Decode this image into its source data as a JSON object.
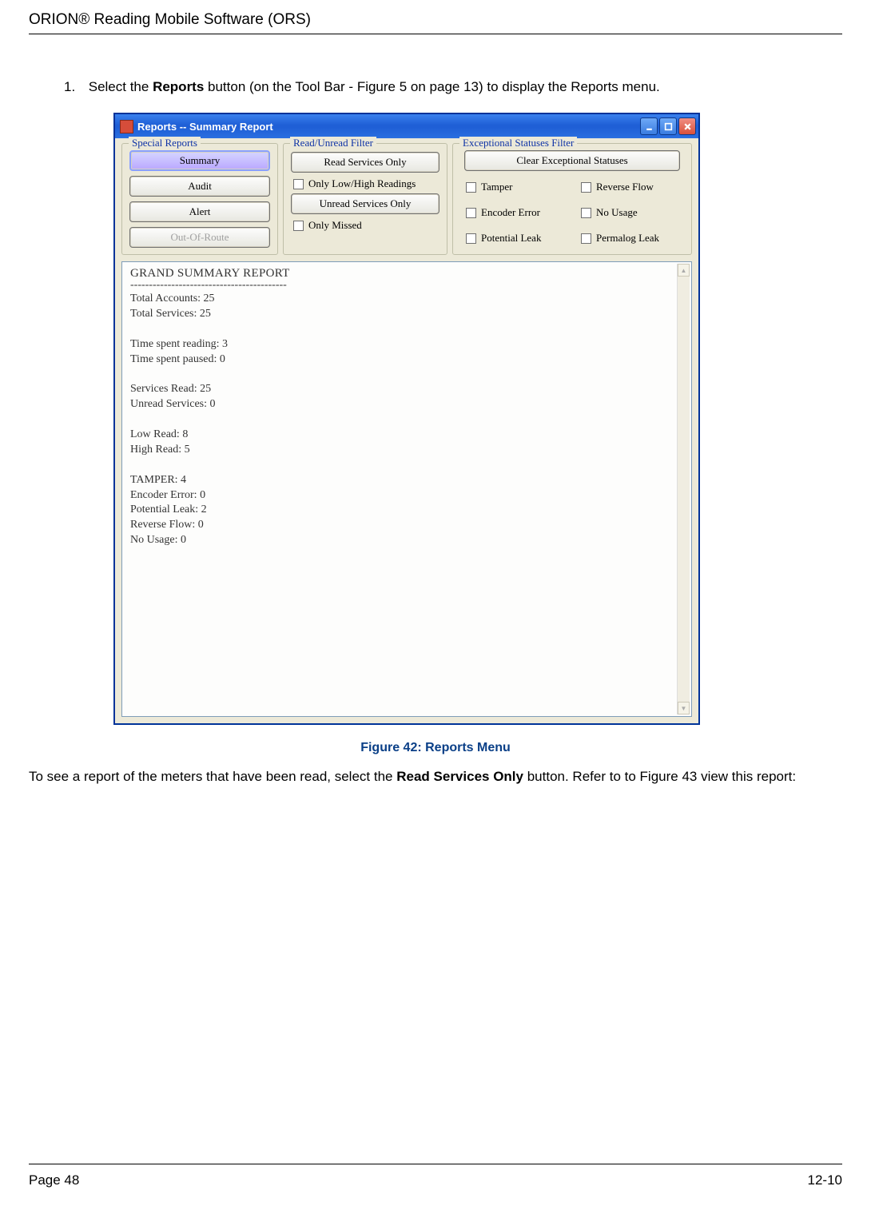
{
  "header": {
    "title": "ORION® Reading Mobile Software (ORS)"
  },
  "instruction": {
    "number": "1.",
    "prefix": "Select the ",
    "bold": "Reports",
    "suffix": " button (on the Tool Bar - Figure 5 on page 13) to display the Reports menu."
  },
  "window": {
    "title": "Reports  -- Summary Report"
  },
  "groups": {
    "special": {
      "label": "Special Reports",
      "buttons": {
        "summary": "Summary",
        "audit": "Audit",
        "alert": "Alert",
        "outofroute": "Out-Of-Route"
      }
    },
    "readfilter": {
      "label": "Read/Unread Filter",
      "read_services": "Read Services Only",
      "only_lowhigh": "Only Low/High Readings",
      "unread_services": "Unread Services Only",
      "only_missed": "Only Missed"
    },
    "exceptional": {
      "label": "Exceptional Statuses Filter",
      "clear": "Clear Exceptional Statuses",
      "tamper": "Tamper",
      "reverse": "Reverse Flow",
      "encoder": "Encoder Error",
      "nousage": "No Usage",
      "potential": "Potential Leak",
      "permalog": "Permalog Leak"
    }
  },
  "report": {
    "title": "GRAND SUMMARY REPORT",
    "lines": [
      "Total Accounts: 25",
      "Total Services: 25",
      "",
      "Time spent reading: 3",
      "Time spent paused: 0",
      "",
      "Services Read: 25",
      "Unread Services: 0",
      "",
      "Low Read: 8",
      "High Read: 5",
      "",
      "TAMPER: 4",
      "Encoder Error: 0",
      "Potential Leak: 2",
      "Reverse Flow: 0",
      "No Usage: 0"
    ]
  },
  "caption": "Figure 42:  Reports Menu",
  "bodytext": {
    "prefix": "To see a report of the meters that have been read, select the ",
    "bold": "Read Services Only",
    "suffix": " button. Refer to to Figure 43 view this report:"
  },
  "footer": {
    "left": "Page 48",
    "right": "12-10"
  }
}
